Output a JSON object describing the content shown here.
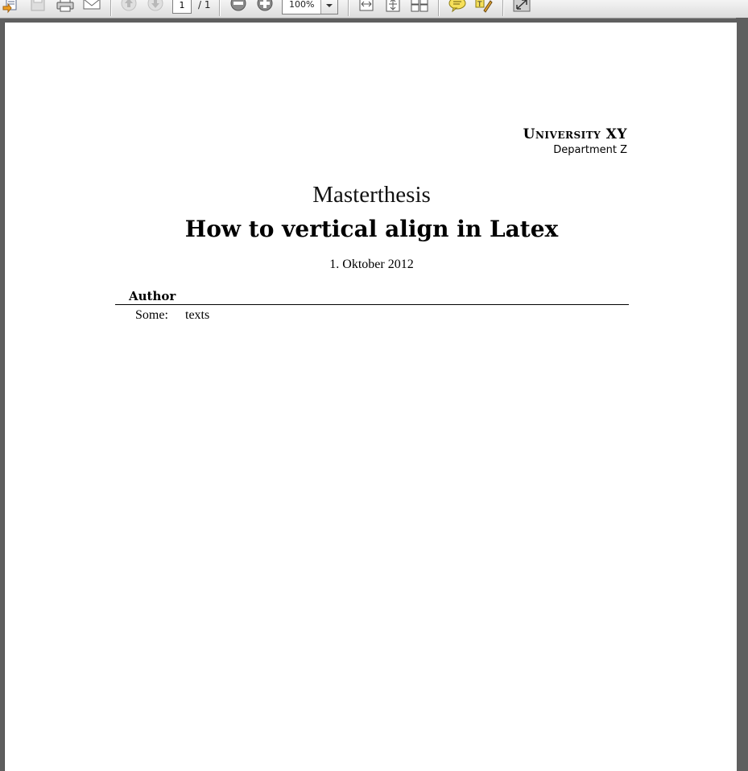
{
  "toolbar": {
    "current_page": "1",
    "page_total": "/ 1",
    "zoom": "100%",
    "icons": [
      "open-icon",
      "save-icon",
      "print-icon",
      "email-icon",
      "previous-page-icon",
      "next-page-icon",
      "zoom-out-icon",
      "zoom-in-icon",
      "fit-width-icon",
      "fit-page-icon",
      "thumbnails-icon",
      "comment-icon",
      "highlight-icon",
      "expand-icon"
    ]
  },
  "document": {
    "university": "University XY",
    "department": "Department Z",
    "thesis_type": "Masterthesis",
    "title": "How to vertical align in Latex",
    "date": "1. Oktober 2012",
    "section_heading": "Author",
    "entry_key": "Some:",
    "entry_value": "texts"
  },
  "colors": {
    "background": "#5f5f5f",
    "page": "#ffffff",
    "toolbar": "#e6e6e6"
  }
}
